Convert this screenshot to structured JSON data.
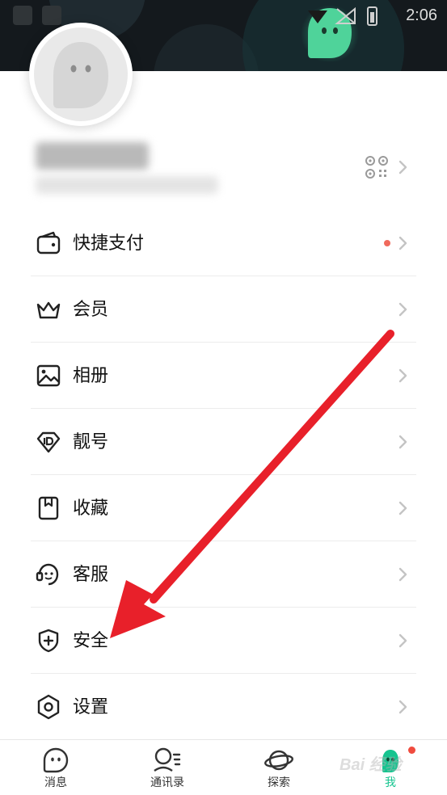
{
  "status_bar": {
    "time": "2:06"
  },
  "profile": {
    "nickname": "",
    "account_id": ""
  },
  "menu": {
    "items": [
      {
        "label": "快捷支付",
        "icon": "wallet-icon",
        "has_dot": true
      },
      {
        "label": "会员",
        "icon": "crown-icon",
        "has_dot": false
      },
      {
        "label": "相册",
        "icon": "image-icon",
        "has_dot": false
      },
      {
        "label": "靓号",
        "icon": "id-diamond-icon",
        "has_dot": false
      },
      {
        "label": "收藏",
        "icon": "bookmark-icon",
        "has_dot": false
      },
      {
        "label": "客服",
        "icon": "customer-service-icon",
        "has_dot": false
      },
      {
        "label": "安全",
        "icon": "shield-icon",
        "has_dot": false
      },
      {
        "label": "设置",
        "icon": "settings-hexagon-icon",
        "has_dot": false
      }
    ]
  },
  "tabbar": {
    "tabs": [
      {
        "label": "消息",
        "icon": "chat-bubble-icon",
        "active": false
      },
      {
        "label": "通讯录",
        "icon": "contacts-icon",
        "active": false
      },
      {
        "label": "探索",
        "icon": "planet-icon",
        "active": false
      },
      {
        "label": "我",
        "icon": "me-mascot-icon",
        "active": true
      }
    ]
  },
  "watermark": {
    "text": "Bai 经验"
  },
  "colors": {
    "header_bg": "#14191d",
    "accent": "#16c48f",
    "notification_dot": "#f06a5c",
    "annotation_arrow": "#e8202a"
  }
}
